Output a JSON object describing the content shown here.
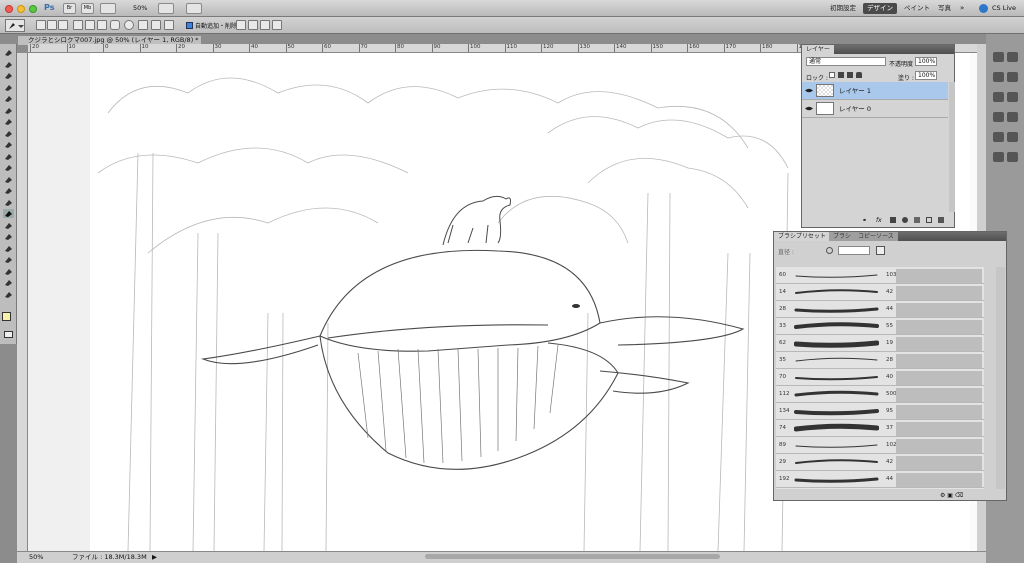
{
  "app": {
    "workspaces": [
      "初期設定",
      "デザイン",
      "ペイント",
      "写真"
    ],
    "active_workspace": "デザイン",
    "cs_live": "CS Live",
    "zoom_menu": "50%",
    "ps_logo": "Ps",
    "ps_br": "Br",
    "ps_mb": "Mb"
  },
  "options_bar": {
    "auto_add_delete_label": "自動追加・削除"
  },
  "document": {
    "tab_title": "クジラとシロクマ007.jpg @ 50% (レイヤー 1, RGB/8) *",
    "ruler_labels": [
      "20",
      "10",
      "0",
      "10",
      "20",
      "30",
      "40",
      "50",
      "60",
      "70",
      "80",
      "90",
      "100",
      "110",
      "120",
      "130",
      "140",
      "150",
      "160",
      "170",
      "180",
      "190",
      "200",
      "210",
      "220",
      "230"
    ]
  },
  "status": {
    "zoom": "50%",
    "file_info": "ファイル : 18.3M/18.3M"
  },
  "layers_panel": {
    "tab": "レイヤー",
    "blend_mode": "通常",
    "opacity_label": "不透明度 :",
    "opacity_value": "100%",
    "lock_label": "ロック :",
    "fill_label": "塗り :",
    "fill_value": "100%",
    "layers": [
      {
        "name": "レイヤー 1",
        "selected": true
      },
      {
        "name": "レイヤー 0",
        "selected": false
      }
    ]
  },
  "brush_panel": {
    "tabs": [
      "ブラシプリセット",
      "ブラシ",
      "コピーソース"
    ],
    "size_label": "直径 :",
    "left_sizes": [
      "60",
      "14",
      "28",
      "33",
      "62",
      "35",
      "70",
      "112",
      "134",
      "74",
      "89",
      "29",
      "192"
    ],
    "right_sizes": [
      "103",
      "42",
      "44",
      "55",
      "19",
      "28",
      "40",
      "500",
      "95",
      "37",
      "102",
      "42",
      "44"
    ]
  }
}
